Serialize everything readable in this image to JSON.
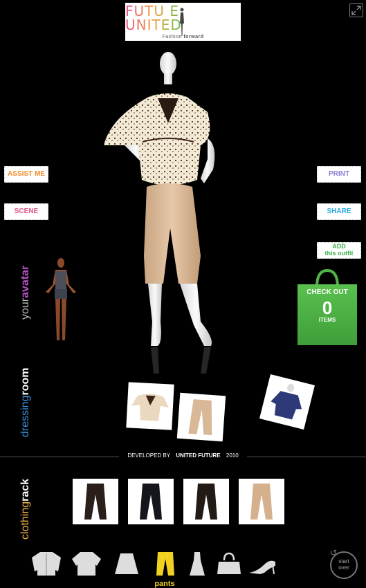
{
  "logo": {
    "brand": "FUTU E UNITED",
    "tagline_a": "Fashion ",
    "tagline_b": "forward"
  },
  "buttons": {
    "assist": "ASSIST ME",
    "scene": "SCENE",
    "print": "PRINT",
    "share": "SHARE",
    "add_line1": "ADD",
    "add_line2": "this outfit"
  },
  "labels": {
    "your_a": "your",
    "your_b": "avatar",
    "dress_a": "dressing",
    "dress_b": "room",
    "rack_a": "clothing",
    "rack_b": "rack"
  },
  "checkout": {
    "label": "CHECK OUT",
    "count": "0",
    "items": "ITEMS"
  },
  "footer": {
    "dev_a": "DEVELOPED BY ",
    "dev_b": "UNITED FUTURE",
    "dev_c": " 2010"
  },
  "categories": [
    {
      "name": "jacket-icon"
    },
    {
      "name": "shirt-icon"
    },
    {
      "name": "skirt-icon"
    },
    {
      "name": "pants-icon",
      "label": "pants",
      "selected": true
    },
    {
      "name": "dress-icon"
    },
    {
      "name": "bag-icon"
    },
    {
      "name": "heel-icon"
    }
  ],
  "rack_items": [
    {
      "name": "black-pants-1"
    },
    {
      "name": "black-pants-2"
    },
    {
      "name": "black-pants-3"
    },
    {
      "name": "tan-pants"
    }
  ],
  "startover": {
    "line1": "start",
    "line2": "over"
  },
  "colors": {
    "accent_yellow": "#f0d020",
    "bag_green": "#4fb346"
  }
}
